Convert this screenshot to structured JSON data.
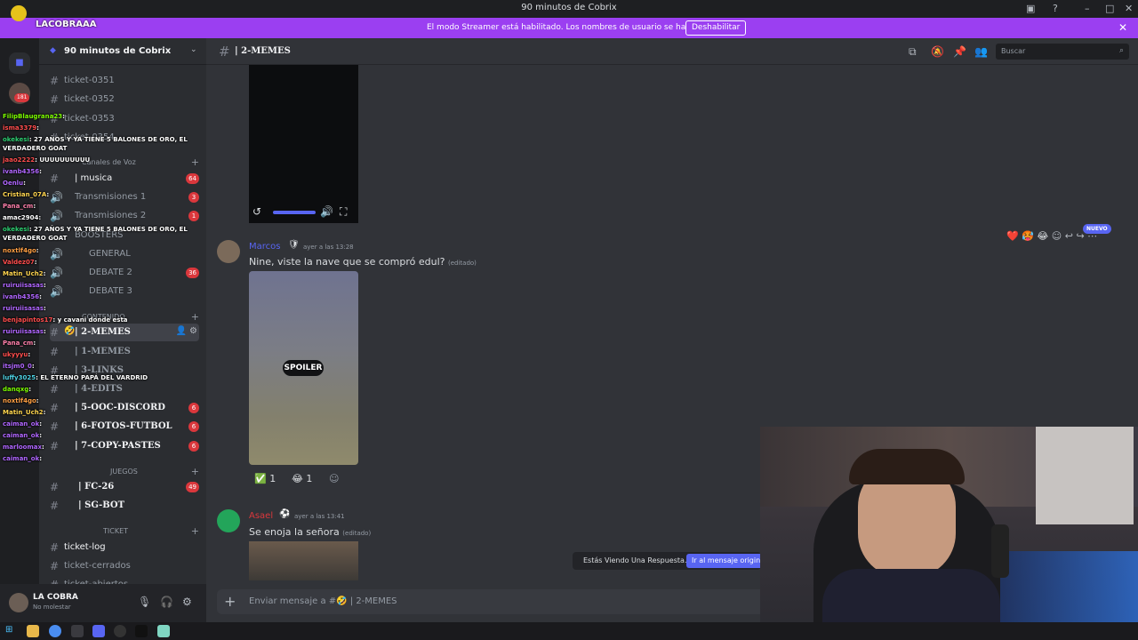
{
  "window": {
    "title": "90 minutos de Cobrix"
  },
  "streamer_banner": {
    "message": "El modo Streamer está habilitado. Los nombres de usuario se han truncado.",
    "disable_label": "Deshabilitar"
  },
  "overlay": {
    "streamer_name": "LACOBRAAA",
    "rail_badge": "181"
  },
  "server": {
    "name": "90 minutos de Cobrix"
  },
  "sidebar": {
    "channels": [
      {
        "label": "ticket-0351"
      },
      {
        "label": "ticket-0352"
      },
      {
        "label": "ticket-0353"
      },
      {
        "label": "ticket-0354"
      }
    ],
    "voice_category": "Canales de Voz",
    "voice": [
      {
        "label": "| musica",
        "badge": "64"
      },
      {
        "label": "Transmisiones 1",
        "badge": "3"
      },
      {
        "label": "Transmisiones 2",
        "badge": "1"
      },
      {
        "label": "BOOSTERS"
      },
      {
        "label": "GENERAL"
      },
      {
        "label": "DEBATE 2",
        "badge": "36"
      },
      {
        "label": "DEBATE 3"
      }
    ],
    "content_category": "CONTENIDO",
    "content": [
      {
        "label": "| 2-MEMES"
      },
      {
        "label": "| 1-MEMES"
      },
      {
        "label": "| 3-LINKS"
      },
      {
        "label": "| 4-EDITS"
      },
      {
        "label": "| 5-OOC-DISCORD",
        "badge": "6"
      },
      {
        "label": "| 6-FOTOS-FUTBOL",
        "badge": "6"
      },
      {
        "label": "| 7-COPY-PASTES",
        "badge": "6"
      }
    ],
    "games_category": "JUEGOS",
    "games": [
      {
        "label": "| FC-26",
        "badge": "49"
      },
      {
        "label": "| SG-BOT"
      }
    ],
    "ticket_category": "TICKET",
    "tickets": [
      {
        "label": "ticket-log"
      },
      {
        "label": "ticket-cerrados"
      },
      {
        "label": "ticket-abiertos"
      }
    ]
  },
  "user": {
    "name": "LA COBRA",
    "status": "No molestar"
  },
  "channel_header": {
    "name": "| 2-MEMES",
    "search_placeholder": "Buscar"
  },
  "messages": [
    {
      "author": "Marcos",
      "time": "ayer a las 13:28",
      "text": "Nine, viste la nave que se compró edul?",
      "edited": "(editado)",
      "spoiler_label": "SPOILER",
      "reactions": [
        {
          "emoji": "✅",
          "count": "1"
        },
        {
          "emoji": "😂",
          "count": "1"
        }
      ]
    },
    {
      "author": "Asael",
      "time": "ayer a las 13:41",
      "text": "Se enoja la señora",
      "edited": "(editado)"
    }
  ],
  "new_badge": "NUEVO",
  "reply_banner": {
    "text": "Estás Viendo Una Respuesta.",
    "button": "Ir al mensaje original"
  },
  "composer": {
    "placeholder": "Enviar mensaje a #🤣 | 2-MEMES"
  },
  "chat_overlay": [
    {
      "user": "FilipBlaugrana23",
      "text": ":",
      "color": "#7cfc00"
    },
    {
      "user": "isma3379",
      "text": ":",
      "color": "#ff4d4d"
    },
    {
      "user": "okekesi",
      "text": ": 27 AÑOS Y YA TIENE 5 BALONES DE ORO, EL",
      "color": "#2ecc71"
    },
    {
      "user": "",
      "text": "VERDADERO GOAT",
      "color": "#ffffff"
    },
    {
      "user": "jaao2222",
      "text": ": UUUUUUUUUU",
      "color": "#ff4d4d"
    },
    {
      "user": "ivanb4356",
      "text": ":",
      "color": "#b066ff"
    },
    {
      "user": "Oenlu",
      "text": ":",
      "color": "#b066ff"
    },
    {
      "user": "Cristian_07A",
      "text": ":",
      "color": "#ffd54f"
    },
    {
      "user": "Pana_cm",
      "text": ":",
      "color": "#ff80ab"
    },
    {
      "user": "amac2904",
      "text": ":",
      "color": "#ffffff"
    },
    {
      "user": "okekesi",
      "text": ": 27 AÑOS Y YA TIENE 5 BALONES DE ORO, EL",
      "color": "#2ecc71"
    },
    {
      "user": "",
      "text": "VERDADERO GOAT",
      "color": "#ffffff"
    },
    {
      "user": "noxtlf4go",
      "text": ":",
      "color": "#ff9f43"
    },
    {
      "user": "Valdez07",
      "text": ":",
      "color": "#ff4d4d"
    },
    {
      "user": "Matin_Uch2",
      "text": ":",
      "color": "#ffd54f"
    },
    {
      "user": "ruiruiisasas",
      "text": ":",
      "color": "#b066ff"
    },
    {
      "user": "ivanb4356",
      "text": ":",
      "color": "#b066ff"
    },
    {
      "user": "ruiruiisasas",
      "text": ":",
      "color": "#b066ff"
    },
    {
      "user": "benjapintos17",
      "text": ": y cavani donde esta",
      "color": "#ff4d4d"
    },
    {
      "user": "ruiruiisasas",
      "text": ":",
      "color": "#b066ff"
    },
    {
      "user": "Pana_cm",
      "text": ":",
      "color": "#ff80ab"
    },
    {
      "user": "ukyyyu",
      "text": ":",
      "color": "#ff4d4d"
    },
    {
      "user": "itsjm0_0",
      "text": ":",
      "color": "#b066ff"
    },
    {
      "user": "luffy3025",
      "text": ": EL ETERNO PAPÁ DEL VARDRID",
      "color": "#4dd0e1"
    },
    {
      "user": "danqxg",
      "text": ":",
      "color": "#7cfc00"
    },
    {
      "user": "noxtlf4go",
      "text": ":",
      "color": "#ff9f43"
    },
    {
      "user": "Matin_Uch2",
      "text": ":",
      "color": "#ffd54f"
    },
    {
      "user": "caiman_ok",
      "text": ":",
      "color": "#b066ff"
    },
    {
      "user": "caiman_ok",
      "text": ":",
      "color": "#b066ff"
    },
    {
      "user": "marloomax",
      "text": ":",
      "color": "#b066ff"
    },
    {
      "user": "caiman_ok",
      "text": ":",
      "color": "#b066ff"
    }
  ]
}
